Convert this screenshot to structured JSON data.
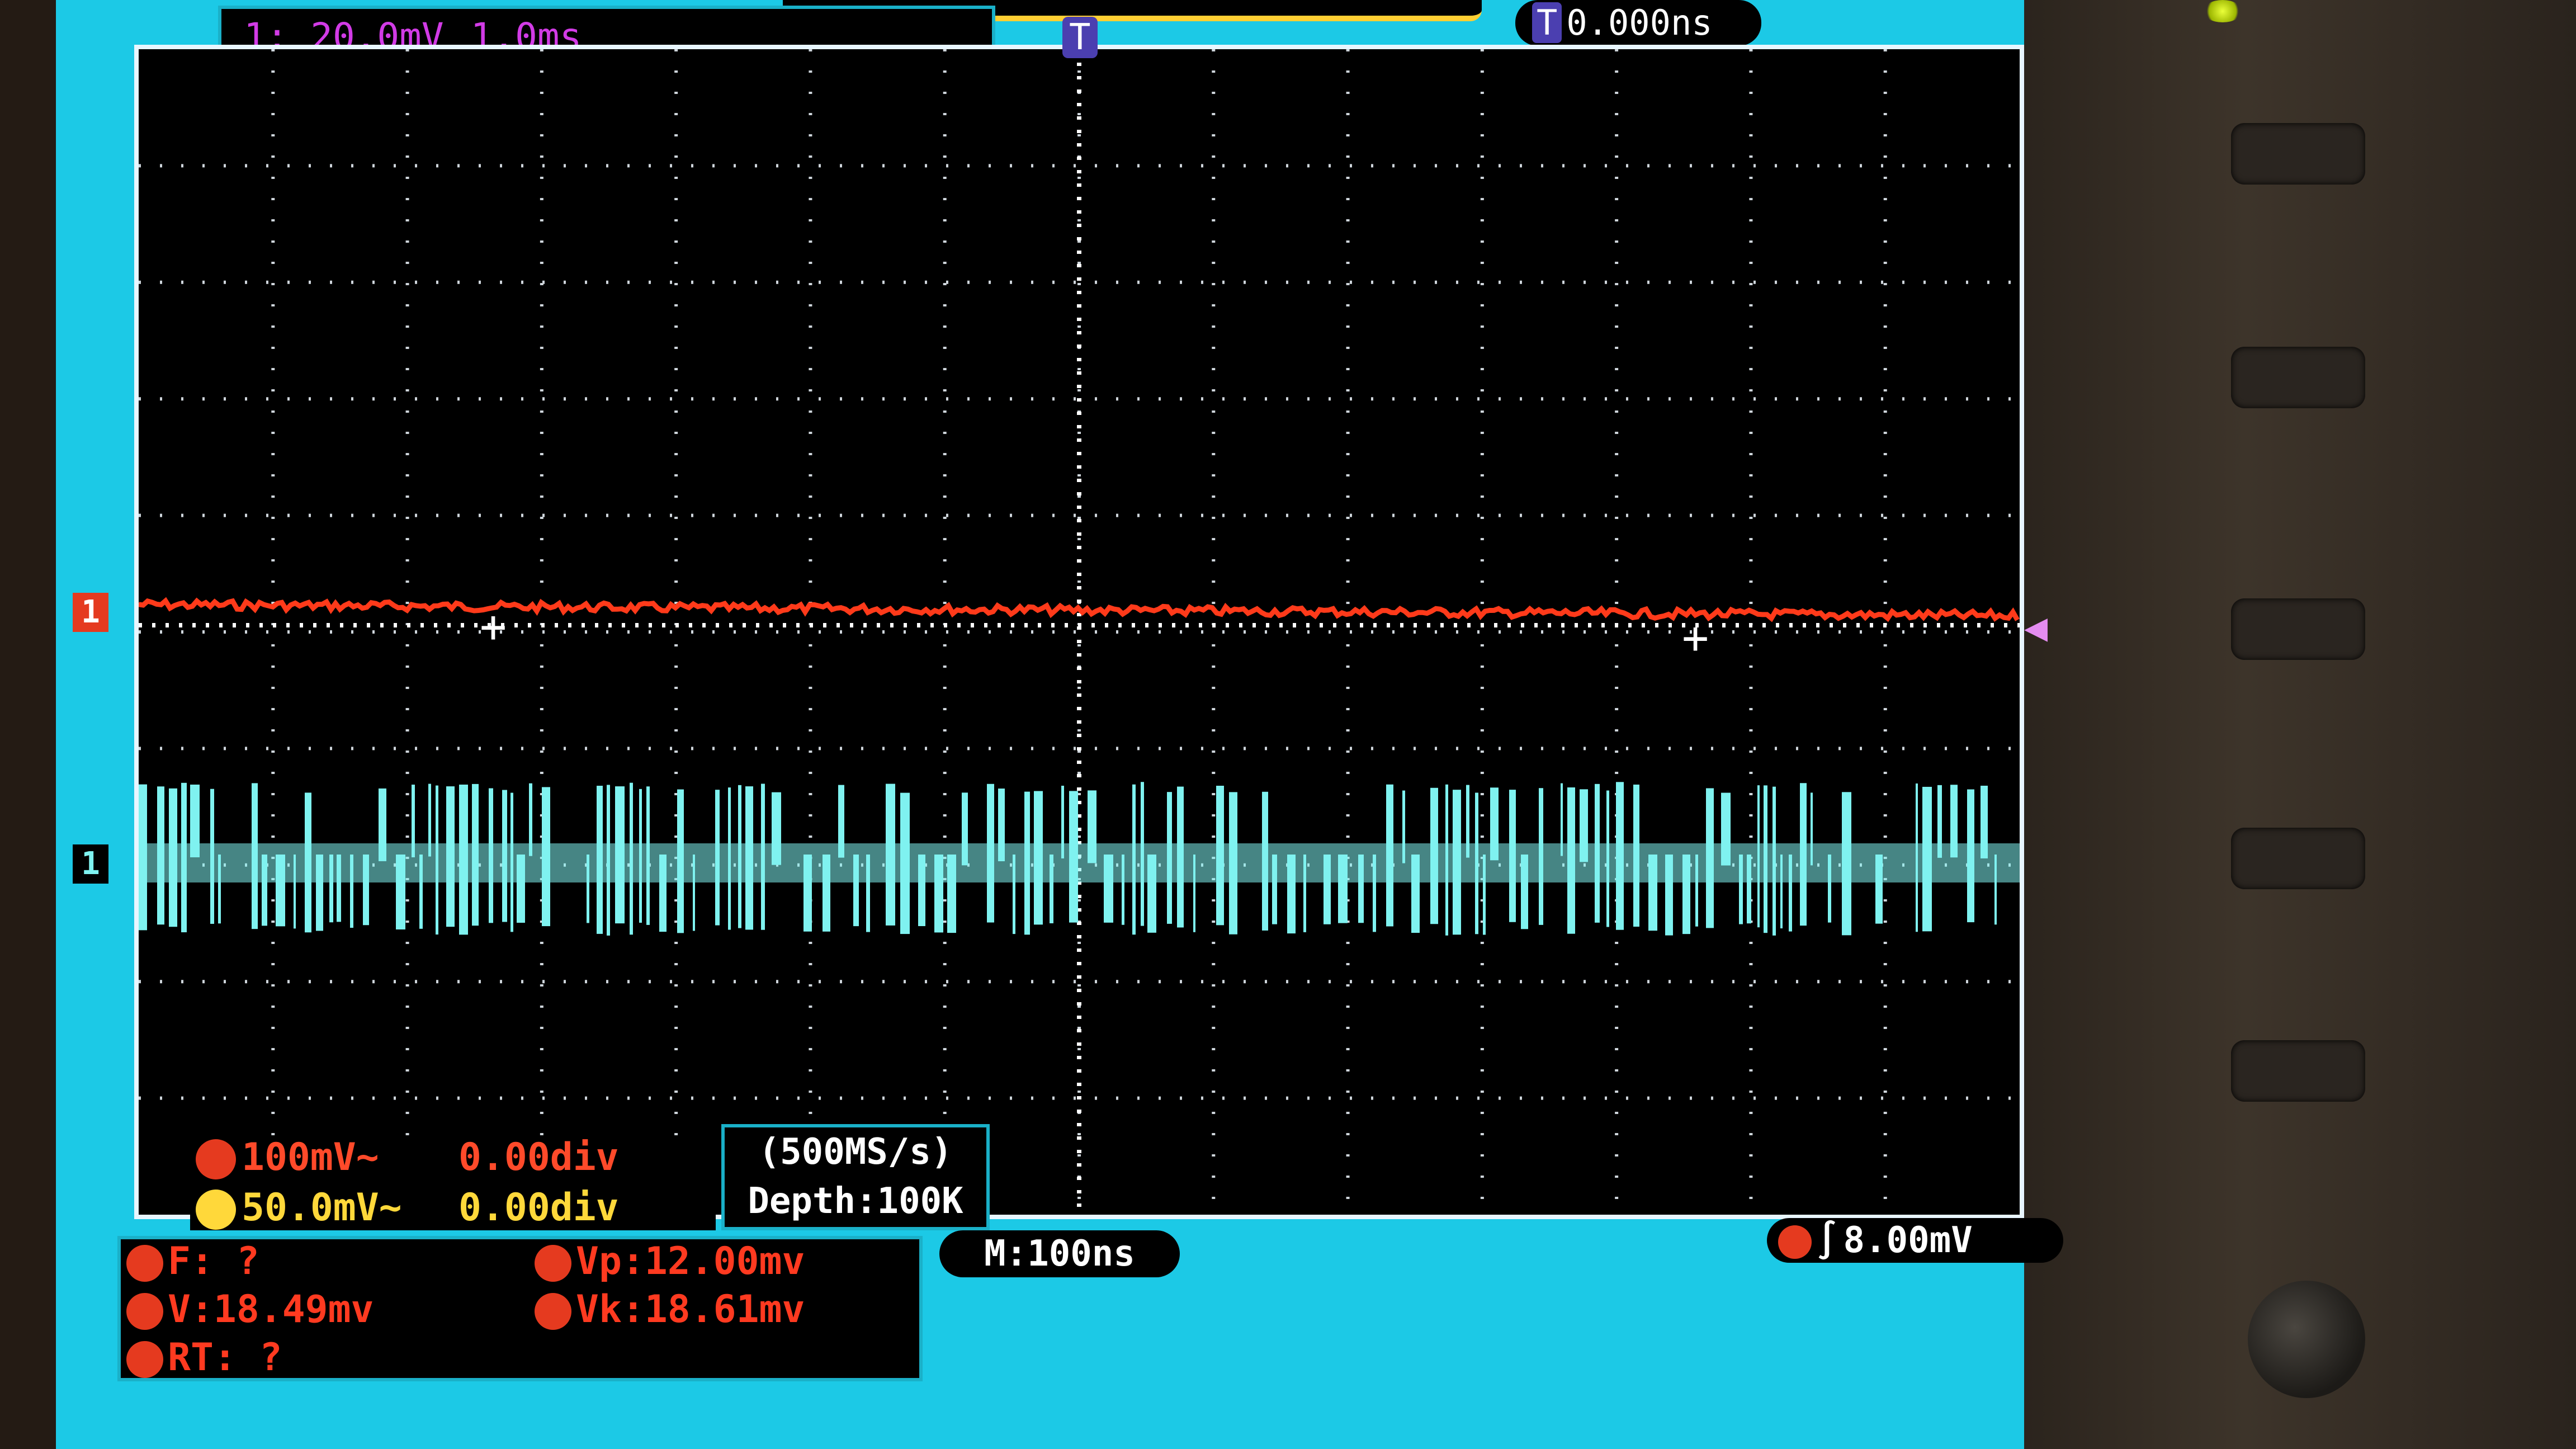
{
  "header": {
    "channel_info": "1: 20.0mV",
    "timebase_info": "1.0ms",
    "trigger_badge": "T",
    "trigger_time": "0.000ns"
  },
  "channels": {
    "ch1": {
      "marker": "1",
      "scale": "100mV~",
      "offset": "0.00div",
      "color": "#e53a1f"
    },
    "ch2": {
      "scale": "50.0mV~",
      "offset": "0.00div",
      "color": "#ffd83a"
    },
    "lower_marker": "1"
  },
  "acquisition": {
    "sample_rate": "(500MS/s)",
    "depth": "Depth:100K"
  },
  "measurements": {
    "f": "F:  ?",
    "vp": "Vp:12.00mv",
    "v": "V:18.49mv",
    "vk": "Vk:18.61mv",
    "rt": "RT:  ?"
  },
  "timebase": "M:100ns",
  "trigger": {
    "edge": "∫",
    "level": "8.00mV"
  },
  "icons": [
    "trigger-position-icon",
    "trigger-level-arrow-icon",
    "rising-edge-icon"
  ],
  "colors": {
    "screen": "#1cc9e6",
    "trace_ch1": "#ff3a1a",
    "trace_digital": "#7ff2f0"
  }
}
